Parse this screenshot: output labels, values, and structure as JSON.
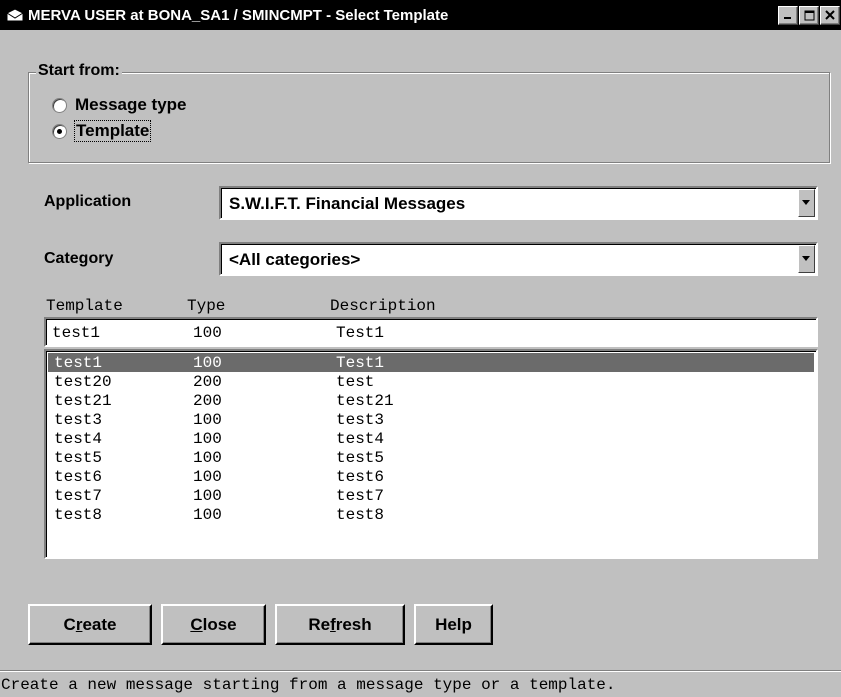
{
  "window": {
    "title": "MERVA USER at BONA_SA1 / SMINCMPT - Select Template",
    "buttons": [
      "minimize",
      "maximize",
      "close"
    ]
  },
  "start_from": {
    "legend": "Start from:",
    "options": [
      {
        "label": "Message type",
        "checked": false
      },
      {
        "label": "Template",
        "checked": true
      }
    ]
  },
  "application": {
    "label": "Application",
    "value": "S.W.I.F.T. Financial Messages"
  },
  "category": {
    "label": "Category",
    "value": "<All categories>"
  },
  "table": {
    "columns": [
      "Template",
      "Type",
      "Description"
    ],
    "current": {
      "template": "test1",
      "type": "100",
      "description": "Test1"
    },
    "rows": [
      {
        "template": "test1",
        "type": "100",
        "description": "Test1",
        "selected": true
      },
      {
        "template": "test20",
        "type": "200",
        "description": "test",
        "selected": false
      },
      {
        "template": "test21",
        "type": "200",
        "description": "test21",
        "selected": false
      },
      {
        "template": "test3",
        "type": "100",
        "description": "test3",
        "selected": false
      },
      {
        "template": "test4",
        "type": "100",
        "description": "test4",
        "selected": false
      },
      {
        "template": "test5",
        "type": "100",
        "description": "test5",
        "selected": false
      },
      {
        "template": "test6",
        "type": "100",
        "description": "test6",
        "selected": false
      },
      {
        "template": "test7",
        "type": "100",
        "description": "test7",
        "selected": false
      },
      {
        "template": "test8",
        "type": "100",
        "description": "test8",
        "selected": false
      }
    ]
  },
  "buttons": {
    "create": {
      "pre": "C",
      "u": "r",
      "post": "eate"
    },
    "close": {
      "pre": "",
      "u": "C",
      "post": "lose"
    },
    "refresh": {
      "pre": "Re",
      "u": "f",
      "post": "resh"
    },
    "help": {
      "pre": "Help",
      "u": "",
      "post": ""
    }
  },
  "status": "Create a new message starting from a message type or a template."
}
